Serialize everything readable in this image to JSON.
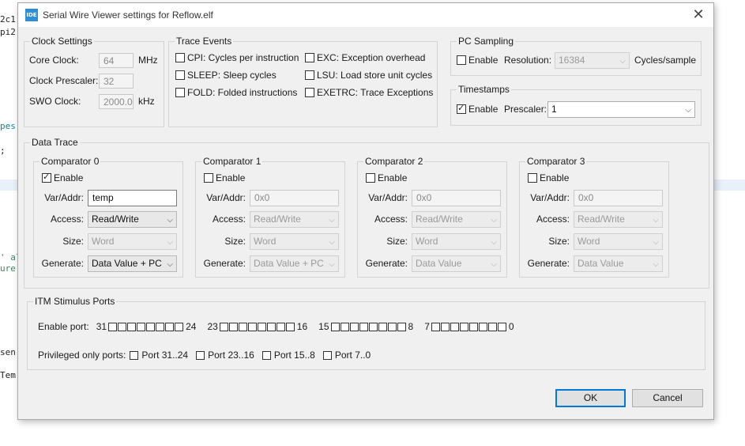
{
  "background": {
    "lines": [
      {
        "text": "2c1"
      },
      {
        "text": "pi2"
      },
      {
        "text": "pes",
        "color": "teal"
      },
      {
        "text": ";"
      },
      {
        "text": "' al",
        "color": "green"
      },
      {
        "text": "ure",
        "color": "green"
      },
      {
        "text": "sen"
      },
      {
        "text": "Tem"
      }
    ]
  },
  "dialog": {
    "icon": "IDE",
    "title": "Serial Wire Viewer settings for Reflow.elf",
    "close_icon": "close-icon"
  },
  "clock": {
    "legend": "Clock Settings",
    "core_label": "Core Clock:",
    "core_value": "64",
    "core_unit": "MHz",
    "prescaler_label": "Clock Prescaler:",
    "prescaler_value": "32",
    "swo_label": "SWO Clock:",
    "swo_value": "2000.0",
    "swo_unit": "kHz"
  },
  "trace": {
    "legend": "Trace Events",
    "items": [
      {
        "label": "CPI: Cycles per instruction",
        "checked": false
      },
      {
        "label": "SLEEP: Sleep cycles",
        "checked": false
      },
      {
        "label": "FOLD: Folded instructions",
        "checked": false
      },
      {
        "label": "EXC: Exception overhead",
        "checked": false
      },
      {
        "label": "LSU: Load store unit cycles",
        "checked": false
      },
      {
        "label": "EXETRC: Trace Exceptions",
        "checked": false
      }
    ]
  },
  "pc_sampling": {
    "legend": "PC Sampling",
    "enable_label": "Enable",
    "resolution_label": "Resolution:",
    "resolution_value": "16384",
    "unit": "Cycles/sample"
  },
  "timestamps": {
    "legend": "Timestamps",
    "enable_label": "Enable",
    "prescaler_label": "Prescaler:",
    "prescaler_value": "1"
  },
  "data_trace": {
    "legend": "Data Trace",
    "var_label": "Var/Addr:",
    "access_label": "Access:",
    "size_label": "Size:",
    "generate_label": "Generate:",
    "enable_label": "Enable",
    "comparators": [
      {
        "title": "Comparator 0",
        "enabled": true,
        "var": "temp",
        "access": "Read/Write",
        "size": "Word",
        "generate": "Data Value + PC"
      },
      {
        "title": "Comparator 1",
        "enabled": false,
        "var": "0x0",
        "access": "Read/Write",
        "size": "Word",
        "generate": "Data Value + PC"
      },
      {
        "title": "Comparator 2",
        "enabled": false,
        "var": "0x0",
        "access": "Read/Write",
        "size": "Word",
        "generate": "Data Value"
      },
      {
        "title": "Comparator 3",
        "enabled": false,
        "var": "0x0",
        "access": "Read/Write",
        "size": "Word",
        "generate": "Data Value"
      }
    ]
  },
  "itm": {
    "legend": "ITM Stimulus Ports",
    "enable_port_label": "Enable port:",
    "groups": [
      {
        "start": "31",
        "end": "24"
      },
      {
        "start": "23",
        "end": "16"
      },
      {
        "start": "15",
        "end": "8"
      },
      {
        "start": "7",
        "end": "0"
      }
    ],
    "privileged_label": "Privileged only ports:",
    "privileged": [
      "Port 31..24",
      "Port 23..16",
      "Port 15..8",
      "Port 7..0"
    ]
  },
  "buttons": {
    "ok": "OK",
    "cancel": "Cancel"
  }
}
